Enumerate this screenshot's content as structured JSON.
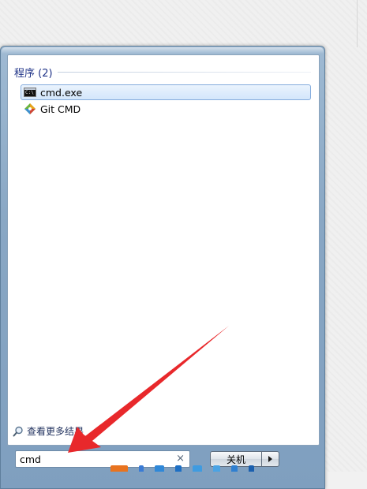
{
  "results": {
    "group_title": "程序 (2)",
    "items": [
      {
        "label": "cmd.exe",
        "icon": "cmd-icon",
        "selected": true
      },
      {
        "label": "Git CMD",
        "icon": "git-icon",
        "selected": false
      }
    ]
  },
  "more_results": {
    "label": "查看更多结果",
    "icon": "search-icon"
  },
  "search": {
    "value": "cmd",
    "clear_glyph": "×"
  },
  "shutdown": {
    "label": "关机"
  },
  "colors": {
    "selection_fill": "#d3e6fb",
    "selection_border": "#84acdd",
    "group_title": "#1e3287",
    "annotation_arrow": "#e8282b",
    "frame": "#89a7c4"
  }
}
